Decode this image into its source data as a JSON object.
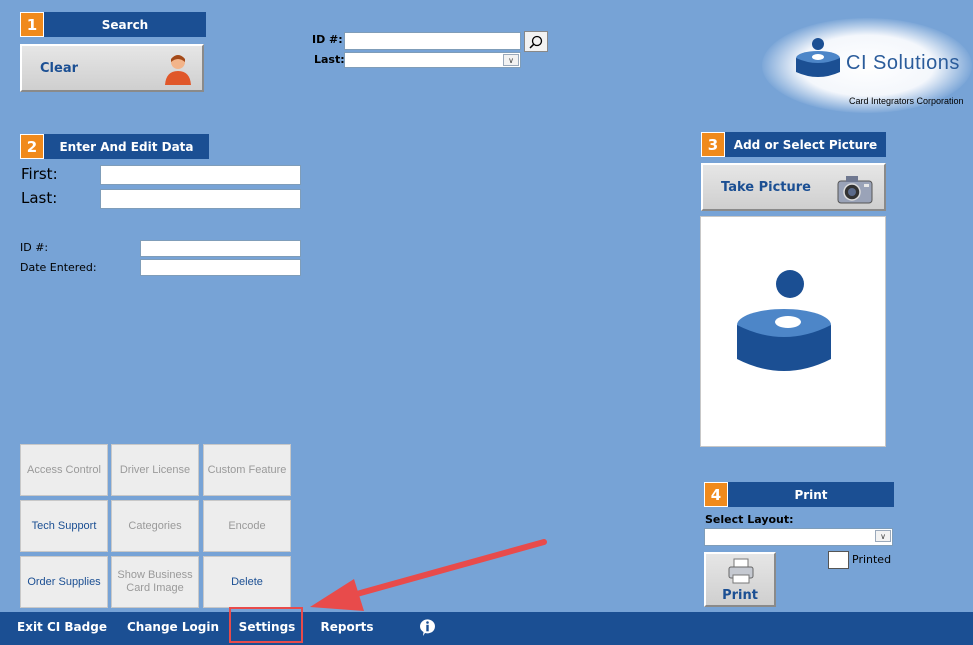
{
  "search": {
    "number": "1",
    "title": "Search",
    "clear_label": "Clear",
    "id_label": "ID #:",
    "last_label": "Last:"
  },
  "logo": {
    "name": "CI Solutions",
    "sub": "Card Integrators Corporation"
  },
  "edit": {
    "number": "2",
    "title": "Enter And Edit Data",
    "first_label": "First:",
    "last_label": "Last:",
    "id_label": "ID #:",
    "date_label": "Date Entered:"
  },
  "picture": {
    "number": "3",
    "title": "Add or Select Picture",
    "take_label": "Take Picture"
  },
  "print": {
    "number": "4",
    "title": "Print",
    "layout_label": "Select Layout:",
    "printed_label": "Printed",
    "print_label": "Print"
  },
  "grid": {
    "access_control": "Access Control",
    "driver_license": "Driver License",
    "custom_feature": "Custom Feature",
    "tech_support": "Tech Support",
    "categories": "Categories",
    "encode": "Encode",
    "order_supplies": "Order Supplies",
    "show_business": "Show Business Card Image",
    "delete": "Delete"
  },
  "bottom": {
    "exit": "Exit CI Badge",
    "change_login": "Change Login",
    "settings": "Settings",
    "reports": "Reports"
  },
  "colors": {
    "background": "#77a3d6",
    "header": "#1b4f93",
    "number_badge": "#f08a1c",
    "annotation": "#e84b4b"
  }
}
